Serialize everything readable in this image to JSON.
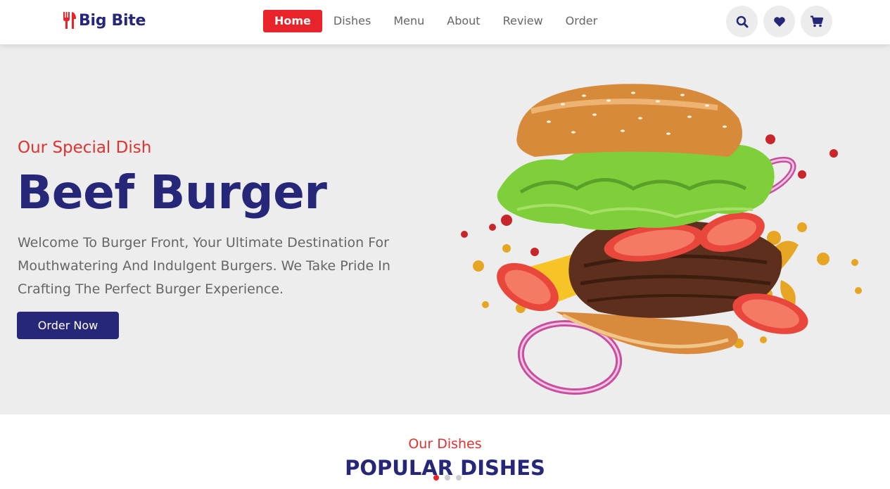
{
  "brand": {
    "name": "Big Bite",
    "logo_icon": "fork-knife-icon",
    "accent": "#e8232a",
    "primary": "#27277a"
  },
  "nav": [
    {
      "label": "Home",
      "active": true
    },
    {
      "label": "Dishes"
    },
    {
      "label": "Menu"
    },
    {
      "label": "About"
    },
    {
      "label": "Review"
    },
    {
      "label": "Order"
    }
  ],
  "header_icons": [
    "search-icon",
    "heart-icon",
    "cart-icon"
  ],
  "hero": {
    "subtitle": "Our Special Dish",
    "title": "Beef Burger",
    "description": "Welcome To Burger Front, Your Ultimate Destination For Mouthwatering And Indulgent Burgers. We Take Pride In Crafting The Perfect Burger Experience.",
    "cta": "Order Now",
    "background": "#ededed"
  },
  "section": {
    "subtitle": "Our Dishes",
    "title": "POPULAR DISHES"
  },
  "slider": {
    "count": 3,
    "active": 1
  }
}
